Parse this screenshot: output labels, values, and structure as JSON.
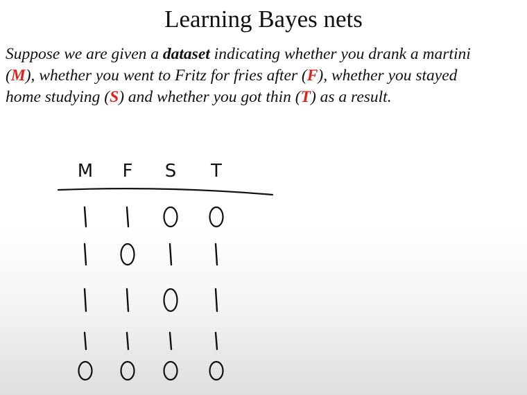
{
  "slide": {
    "title": "Learning Bayes nets"
  },
  "intro": {
    "line1_pre": "Suppose we are given a ",
    "line1_bold": "dataset",
    "line1_post": " indicating whether you drank a martini",
    "line2_open": "(",
    "line2_var": "M",
    "line2_mid": "), whether you went to Fritz for fries after (",
    "line2_var2": "F",
    "line2_post": "), whether you stayed",
    "line3_pre": "home studying (",
    "line3_var": "S",
    "line3_mid": ") and whether you got thin (",
    "line3_var2": "T",
    "line3_post": ") as a result."
  },
  "colors": {
    "variable_highlight": "#e0201a",
    "text": "#111111",
    "ink": "#111111"
  },
  "table": {
    "headers": [
      "M",
      "F",
      "S",
      "T"
    ],
    "rows": [
      [
        "1",
        "1",
        "0",
        "0"
      ],
      [
        "1",
        "0",
        "1",
        "1"
      ],
      [
        "1",
        "1",
        "0",
        "1"
      ],
      [
        "1",
        "1",
        "1",
        "1"
      ],
      [
        "0",
        "0",
        "0",
        "0"
      ]
    ]
  }
}
